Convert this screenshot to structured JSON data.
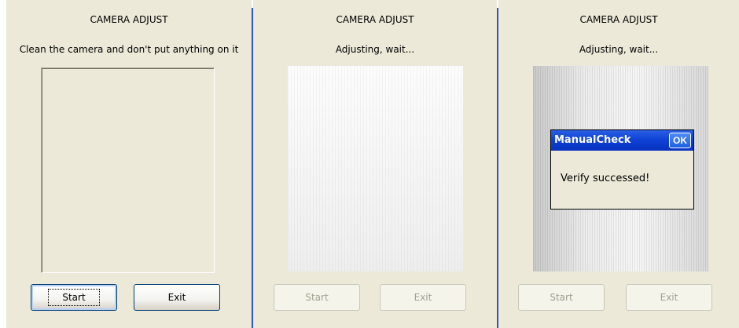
{
  "screens": [
    {
      "title": "CAMERA ADJUST",
      "message": "Clean the camera and don't put anything on it",
      "start_label": "Start",
      "exit_label": "Exit"
    },
    {
      "title": "CAMERA ADJUST",
      "message": "Adjusting, wait...",
      "start_label": "Start",
      "exit_label": "Exit"
    },
    {
      "title": "CAMERA ADJUST",
      "message": "Adjusting, wait...",
      "start_label": "Start",
      "exit_label": "Exit",
      "dialog": {
        "title": "ManualCheck",
        "ok_label": "OK",
        "text": "Verify successed!"
      }
    }
  ],
  "colors": {
    "panel_bg": "#ece9d8",
    "divider": "#2a56c6",
    "dialog_titlebar": "#0f43d6"
  }
}
